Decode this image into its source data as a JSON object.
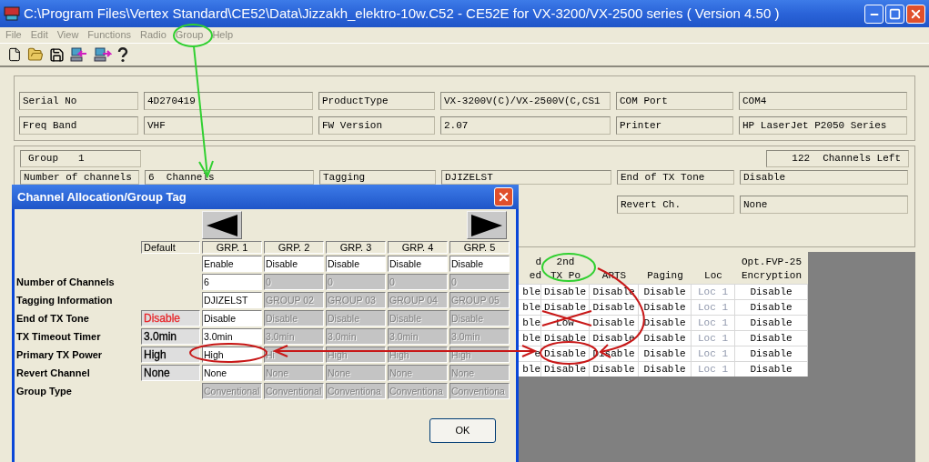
{
  "window": {
    "title": "C:\\Program Files\\Vertex Standard\\CE52\\Data\\Jizzakh_elektro-10w.C52 - CE52E for VX-3200/VX-2500 series ( Version 4.50 )"
  },
  "menu": [
    "File",
    "Edit",
    "View",
    "Functions",
    "Radio",
    "Group",
    "Help"
  ],
  "info": [
    {
      "label": "Serial No",
      "value": "4D270419"
    },
    {
      "label": "ProductType",
      "value": "VX-3200V(C)/VX-2500V(C,CS1"
    },
    {
      "label": "COM Port",
      "value": "COM4"
    },
    {
      "label": "Freq Band",
      "value": "VHF"
    },
    {
      "label": "FW Version",
      "value": "2.07"
    },
    {
      "label": "Printer",
      "value": "HP LaserJet P2050 Series"
    }
  ],
  "group_panel": {
    "group_label": "Group",
    "group_value": "1",
    "channels_left_count": "122",
    "channels_left_label": "Channels Left",
    "fields": [
      {
        "label": "Number of channels",
        "value": "6  Channels"
      },
      {
        "label": "Tagging",
        "value": "DJIZELST"
      },
      {
        "label": "End of TX Tone",
        "value": "Disable"
      },
      {
        "label": "Revert Ch.",
        "value": "None"
      }
    ]
  },
  "table": {
    "columns": [
      {
        "lines": [
          "d",
          "ed"
        ]
      },
      {
        "lines": [
          "2nd",
          "TX Po"
        ]
      },
      {
        "lines": [
          "ARTS"
        ]
      },
      {
        "lines": [
          "Paging"
        ]
      },
      {
        "lines": [
          "Loc"
        ]
      },
      {
        "lines": [
          "Opt.FVP-25",
          "Encryption"
        ]
      }
    ],
    "rows": [
      {
        "cells": [
          {
            "value": "ble",
            "disabled": false
          },
          {
            "value": "Disable",
            "disabled": false
          },
          {
            "value": "Disable",
            "disabled": false
          },
          {
            "value": "Disable",
            "disabled": false
          },
          {
            "value": "Loc 1",
            "disabled": true
          },
          {
            "value": "Disable",
            "disabled": false
          }
        ]
      },
      {
        "cells": [
          {
            "value": "ble",
            "disabled": false
          },
          {
            "value": "Disable",
            "disabled": false
          },
          {
            "value": "Disable",
            "disabled": false
          },
          {
            "value": "Disable",
            "disabled": false
          },
          {
            "value": "Loc 1",
            "disabled": true
          },
          {
            "value": "Disable",
            "disabled": false
          }
        ]
      },
      {
        "cells": [
          {
            "value": "ble",
            "disabled": false
          },
          {
            "value": "Low",
            "disabled": false
          },
          {
            "value": "Disable",
            "disabled": false
          },
          {
            "value": "Disable",
            "disabled": false
          },
          {
            "value": "Loc 1",
            "disabled": true
          },
          {
            "value": "Disable",
            "disabled": false
          }
        ]
      },
      {
        "cells": [
          {
            "value": "ble",
            "disabled": false
          },
          {
            "value": "Disable",
            "disabled": false
          },
          {
            "value": "Disable",
            "disabled": false
          },
          {
            "value": "Disable",
            "disabled": false
          },
          {
            "value": "Loc 1",
            "disabled": true
          },
          {
            "value": "Disable",
            "disabled": false
          }
        ]
      },
      {
        "cells": [
          {
            "value": "e",
            "disabled": false
          },
          {
            "value": "Disable",
            "disabled": false
          },
          {
            "value": "Disable",
            "disabled": false
          },
          {
            "value": "Disable",
            "disabled": false
          },
          {
            "value": "Loc 1",
            "disabled": true
          },
          {
            "value": "Disable",
            "disabled": false
          }
        ]
      },
      {
        "cells": [
          {
            "value": "ble",
            "disabled": false
          },
          {
            "value": "Disable",
            "disabled": false
          },
          {
            "value": "Disable",
            "disabled": false
          },
          {
            "value": "Disable",
            "disabled": false
          },
          {
            "value": "Loc 1",
            "disabled": true
          },
          {
            "value": "Disable",
            "disabled": false
          }
        ]
      }
    ]
  },
  "dialog": {
    "title": "Channel Allocation/Group Tag",
    "columns": [
      "Default",
      "GRP. 1",
      "GRP. 2",
      "GRP. 3",
      "GRP. 4",
      "GRP. 5"
    ],
    "rows": [
      {
        "cells": [
          "",
          {
            "value": "Enable",
            "enabled": true
          },
          {
            "value": "Disable",
            "enabled": true
          },
          {
            "value": "Disable",
            "enabled": true
          },
          {
            "value": "Disable",
            "enabled": true
          },
          {
            "value": "Disable",
            "enabled": true
          }
        ]
      },
      {
        "label": "Number of Channels",
        "cells": [
          "",
          {
            "value": "6",
            "enabled": true
          },
          {
            "value": "0",
            "enabled": false
          },
          {
            "value": "0",
            "enabled": false
          },
          {
            "value": "0",
            "enabled": false
          },
          {
            "value": "0",
            "enabled": false
          }
        ]
      },
      {
        "label": "Tagging Information",
        "cells": [
          "",
          {
            "value": "DJIZELST",
            "enabled": true
          },
          {
            "value": "GROUP 02",
            "enabled": false
          },
          {
            "value": "GROUP 03",
            "enabled": false
          },
          {
            "value": "GROUP 04",
            "enabled": false
          },
          {
            "value": "GROUP 05",
            "enabled": false
          }
        ]
      },
      {
        "label": "End of TX Tone",
        "cells": [
          {
            "value": "Disable",
            "color": "#e8282c"
          },
          {
            "value": "Disable",
            "enabled": true
          },
          {
            "value": "Disable",
            "enabled": false
          },
          {
            "value": "Disable",
            "enabled": false
          },
          {
            "value": "Disable",
            "enabled": false
          },
          {
            "value": "Disable",
            "enabled": false
          }
        ]
      },
      {
        "label": "TX Timeout Timer",
        "cells": [
          {
            "value": "3.0min",
            "color": "#000000"
          },
          {
            "value": "3.0min",
            "enabled": true
          },
          {
            "value": "3.0min",
            "enabled": false
          },
          {
            "value": "3.0min",
            "enabled": false
          },
          {
            "value": "3.0min",
            "enabled": false
          },
          {
            "value": "3.0min",
            "enabled": false
          }
        ]
      },
      {
        "label": "Primary TX Power",
        "cells": [
          {
            "value": "High",
            "color": "#000000"
          },
          {
            "value": "High",
            "enabled": true
          },
          {
            "value": "Hi",
            "enabled": false
          },
          {
            "value": "High",
            "enabled": false
          },
          {
            "value": "High",
            "enabled": false
          },
          {
            "value": "High",
            "enabled": false
          }
        ]
      },
      {
        "label": "Revert Channel",
        "cells": [
          {
            "value": "None",
            "color": "#000000"
          },
          {
            "value": "None",
            "enabled": true
          },
          {
            "value": "None",
            "enabled": false
          },
          {
            "value": "None",
            "enabled": false
          },
          {
            "value": "None",
            "enabled": false
          },
          {
            "value": "None",
            "enabled": false
          }
        ]
      },
      {
        "label": "Group Type",
        "cells": [
          "",
          {
            "value": "Conventional",
            "enabled": false
          },
          {
            "value": "Conventional",
            "enabled": false
          },
          {
            "value": "Conventiona",
            "enabled": false
          },
          {
            "value": "Conventiona",
            "enabled": false
          },
          {
            "value": "Conventiona",
            "enabled": false
          }
        ]
      }
    ],
    "ok_button": "OK"
  }
}
